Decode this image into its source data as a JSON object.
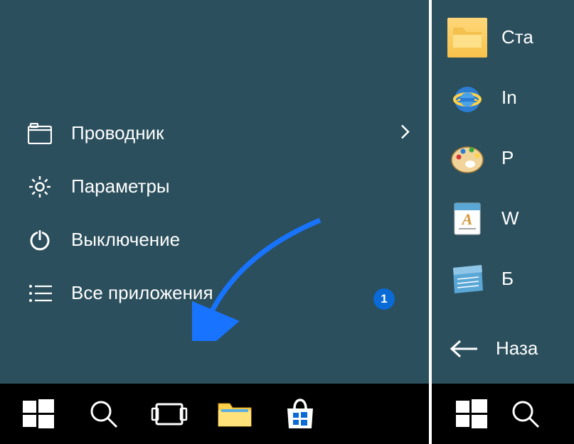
{
  "menu": {
    "explorer": {
      "label": "Проводник"
    },
    "settings": {
      "label": "Параметры"
    },
    "power": {
      "label": "Выключение"
    },
    "all_apps": {
      "label": "Все приложения"
    }
  },
  "badge": {
    "count": "1"
  },
  "tiles": [
    {
      "label": "Ста"
    },
    {
      "label": "In"
    },
    {
      "label": "P"
    },
    {
      "label": "W"
    },
    {
      "label": "Б"
    }
  ],
  "back": {
    "label": "Наза"
  }
}
